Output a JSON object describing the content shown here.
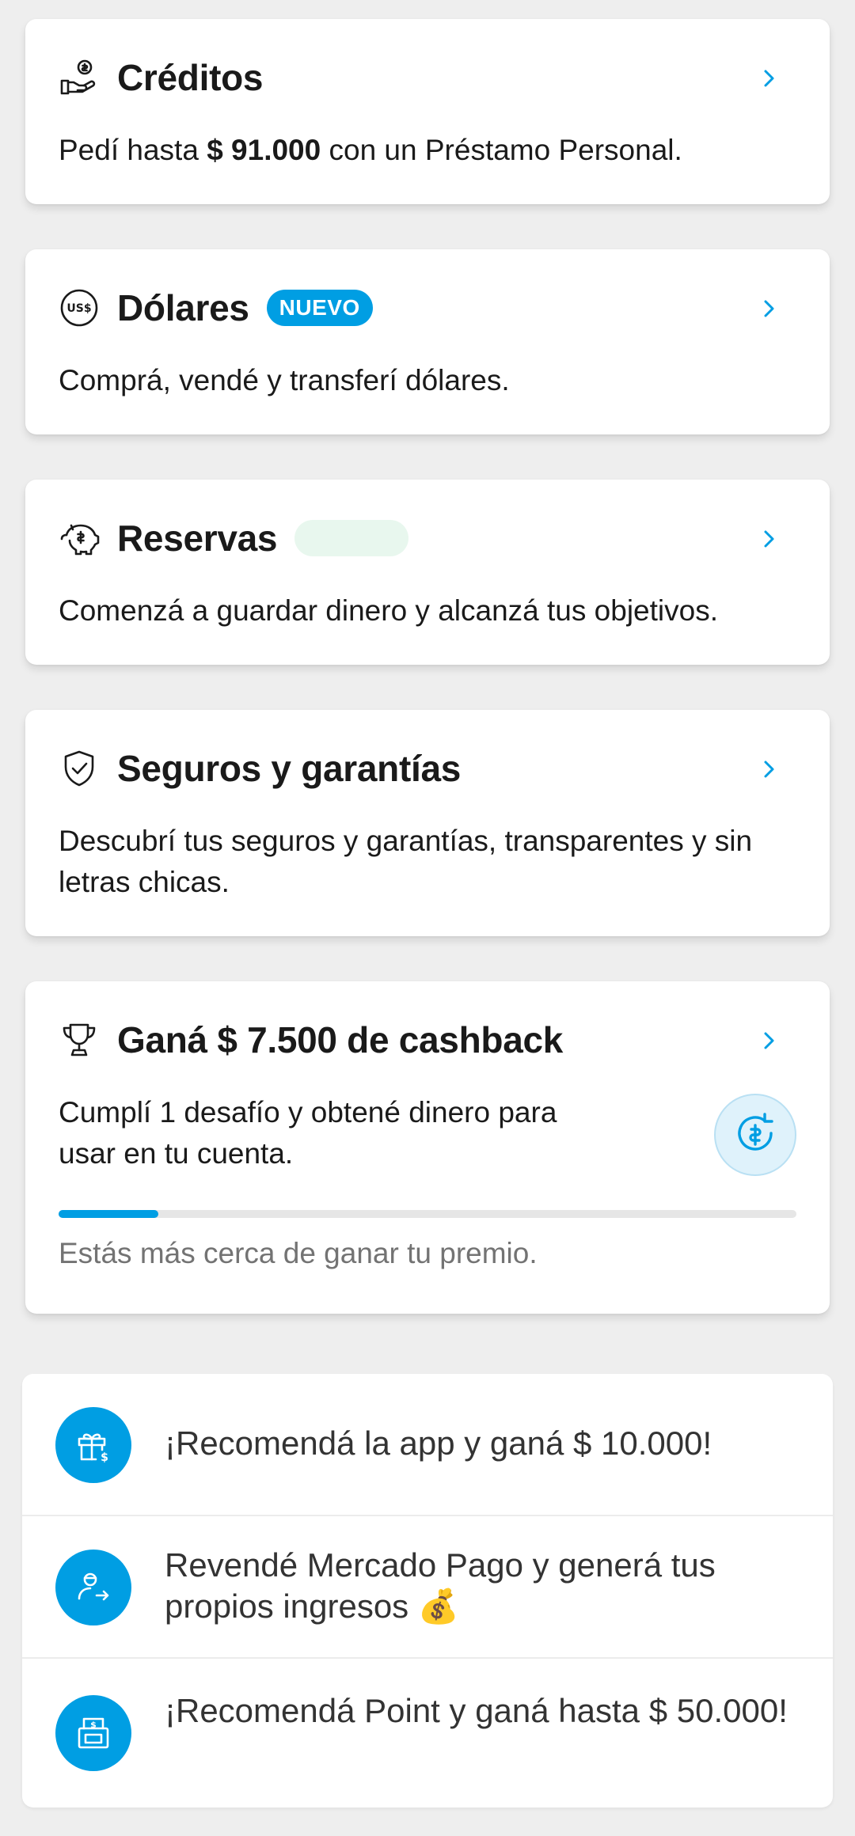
{
  "colors": {
    "accent": "#009ee3",
    "text": "#1a1a1a",
    "muted": "#737373",
    "background": "#eeeeee"
  },
  "credits": {
    "title": "Créditos",
    "icon": "hand-coin-icon",
    "text_before": "Pedí hasta ",
    "amount": "$ 91.000",
    "text_after": " con un Préstamo Personal."
  },
  "dollars": {
    "title": "Dólares",
    "badge": "NUEVO",
    "icon": "usd-coin-icon",
    "text": "Comprá, vendé y transferí dólares."
  },
  "reserves": {
    "title": "Reservas",
    "icon": "piggy-bank-icon",
    "text": "Comenzá a guardar dinero y alcanzá tus objetivos."
  },
  "insurance": {
    "title": "Seguros y garantías",
    "icon": "shield-check-icon",
    "text": "Descubrí tus seguros y garantías, transparentes y sin letras chicas."
  },
  "cashback": {
    "title": "Ganá $ 7.500 de cashback",
    "icon": "trophy-icon",
    "text": "Cumplí 1 desafío y obtené dinero para usar en tu cuenta.",
    "progress": 0.135,
    "progress_text": "Estás más cerca de ganar tu premio.",
    "badge_icon": "refresh-dollar-icon"
  },
  "recommendations": [
    {
      "icon": "gift-dollar-icon",
      "text": "¡Recomendá la app y ganá $ 10.000!"
    },
    {
      "icon": "person-arrow-icon",
      "text": "Revendé Mercado Pago y generá tus propios ingresos 💰"
    },
    {
      "icon": "point-device-icon",
      "text": "¡Recomendá Point y ganá hasta $ 50.000!"
    }
  ]
}
